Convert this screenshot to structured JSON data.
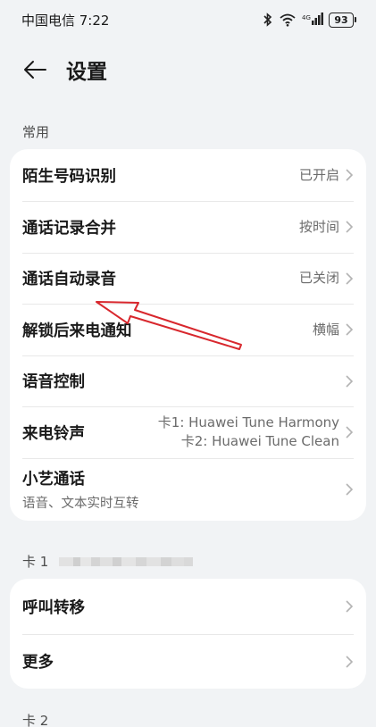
{
  "status_bar": {
    "carrier_time": "中国电信 7:22",
    "signal_label": "4G",
    "battery": "93"
  },
  "header": {
    "title": "设置"
  },
  "sections": {
    "common": {
      "title": "常用",
      "items": [
        {
          "label": "陌生号码识别",
          "value": "已开启"
        },
        {
          "label": "通话记录合并",
          "value": "按时间"
        },
        {
          "label": "通话自动录音",
          "value": "已关闭"
        },
        {
          "label": "解锁后来电通知",
          "value": "横幅"
        },
        {
          "label": "语音控制",
          "value": ""
        },
        {
          "label": "来电铃声",
          "value_line1": "卡1: Huawei Tune Harmony",
          "value_line2": "卡2: Huawei Tune Clean"
        },
        {
          "label": "小艺通话",
          "subtitle": "语音、文本实时互转"
        }
      ]
    },
    "card1": {
      "title": "卡 1",
      "items": [
        {
          "label": "呼叫转移"
        },
        {
          "label": "更多"
        }
      ]
    },
    "card2": {
      "title": "卡 2"
    }
  },
  "colors": {
    "background": "#f1f3f5",
    "card": "#ffffff",
    "annotation_arrow": "#d8272d"
  }
}
